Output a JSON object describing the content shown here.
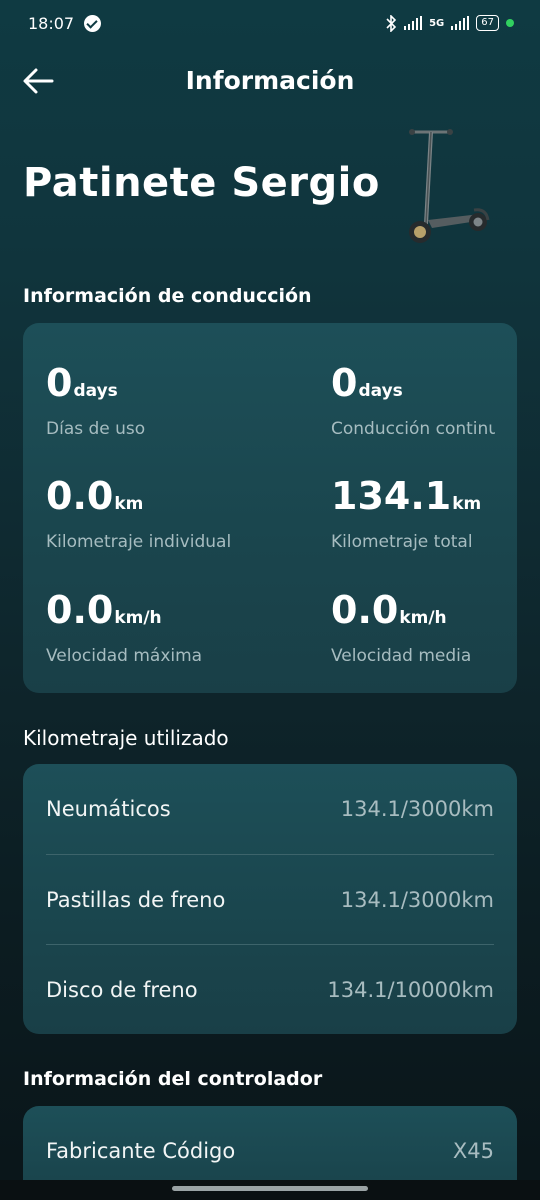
{
  "status_bar": {
    "time": "18:07",
    "network": "5G",
    "battery": "67"
  },
  "header": {
    "title": "Información"
  },
  "device": {
    "name": "Patinete Sergio"
  },
  "driving_info": {
    "title": "Información de conducción",
    "stats": [
      {
        "value": "0",
        "unit": "days",
        "label": "Días de uso"
      },
      {
        "value": "0",
        "unit": "days",
        "label": "Conducción continua"
      },
      {
        "value": "0.0",
        "unit": "km",
        "label": "Kilometraje individual"
      },
      {
        "value": "134.1",
        "unit": "km",
        "label": "Kilometraje total"
      },
      {
        "value": "0.0",
        "unit": "km/h",
        "label": "Velocidad máxima"
      },
      {
        "value": "0.0",
        "unit": "km/h",
        "label": "Velocidad media"
      }
    ]
  },
  "mileage_used": {
    "title": "Kilometraje utilizado",
    "rows": [
      {
        "label": "Neumáticos",
        "value": "134.1/3000km"
      },
      {
        "label": "Pastillas de freno",
        "value": "134.1/3000km"
      },
      {
        "label": "Disco de freno",
        "value": "134.1/10000km"
      }
    ]
  },
  "controller_info": {
    "title": "Información del controlador",
    "rows": [
      {
        "label": "Fabricante Código",
        "value": "X45"
      }
    ]
  }
}
